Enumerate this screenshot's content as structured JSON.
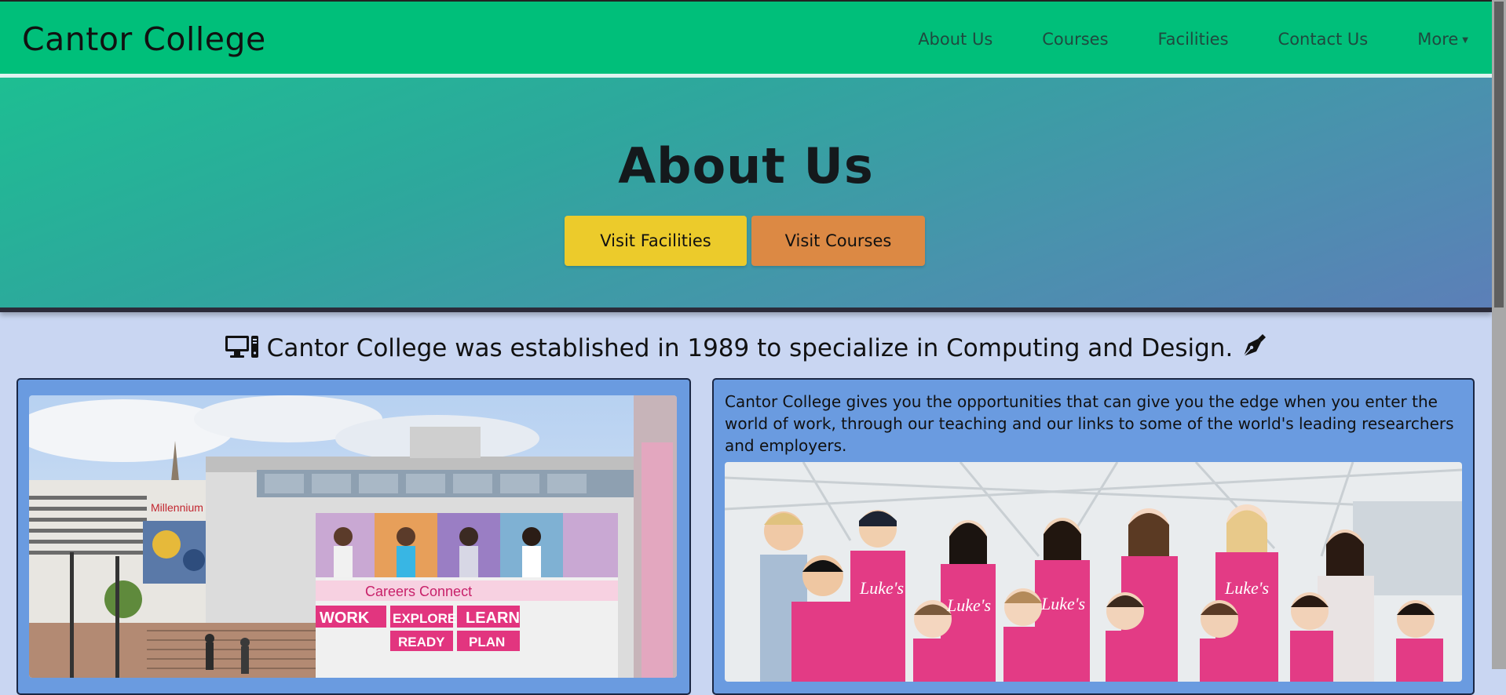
{
  "header": {
    "brand": "Cantor College",
    "nav": [
      {
        "label": "About Us"
      },
      {
        "label": "Courses"
      },
      {
        "label": "Facilities"
      },
      {
        "label": "Contact Us"
      },
      {
        "label": "More"
      }
    ]
  },
  "hero": {
    "title": "About Us",
    "buttons": {
      "facilities": "Visit Facilities",
      "courses": "Visit Courses"
    }
  },
  "intro": {
    "text": "Cantor College was established in 1989 to specialize in Computing and Design.",
    "left_icon": "desktop-computer-icon",
    "right_icon": "pen-nib-icon"
  },
  "panels": {
    "left": {
      "photo": {
        "description_icon": "campus-building-photo",
        "sign_text": "Careers Connect",
        "gallery_text": "Millennium Gallery",
        "words": [
          "WORK",
          "EXPLORE",
          "LEARN",
          "READY",
          "PLAN"
        ]
      }
    },
    "right": {
      "text": "Cantor College gives you the opportunities that can give you the edge when you enter the world of work, through our teaching and our links to some of the world's leading researchers and employers.",
      "photo": {
        "description_icon": "students-group-photo",
        "shirt_text": "Luke's"
      }
    }
  },
  "colors": {
    "navbar": "#00bf7a",
    "hero_start": "#1dbe92",
    "hero_end": "#5c7fb8",
    "btn_facilities": "#eccb2b",
    "btn_courses": "#dc8944",
    "panel": "#6a9be0",
    "page_bg": "#c9d6f2"
  }
}
